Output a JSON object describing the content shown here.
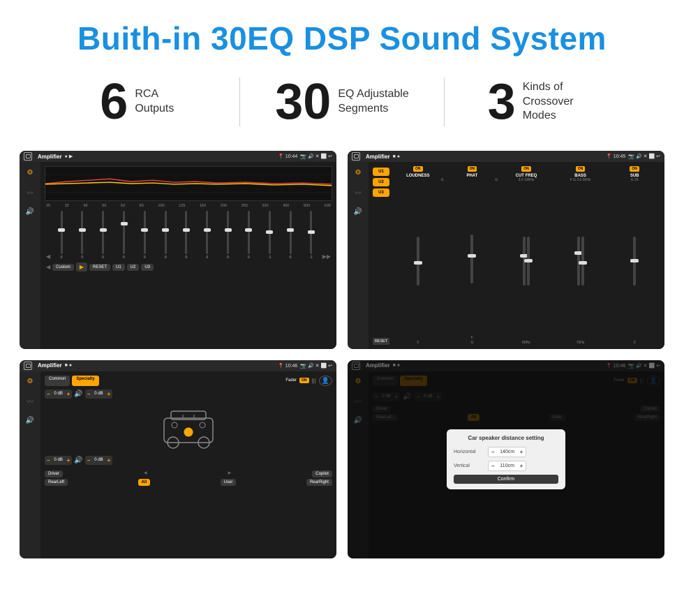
{
  "header": {
    "title": "Buith-in 30EQ DSP Sound System"
  },
  "stats": [
    {
      "number": "6",
      "label": "RCA\nOutputs"
    },
    {
      "number": "30",
      "label": "EQ Adjustable\nSegments"
    },
    {
      "number": "3",
      "label": "Kinds of\nCrossover Modes"
    }
  ],
  "screens": [
    {
      "id": "eq-screen",
      "statusBar": {
        "appName": "Amplifier",
        "time": "10:44"
      },
      "type": "equalizer"
    },
    {
      "id": "amp-screen",
      "statusBar": {
        "appName": "Amplifier",
        "time": "10:45"
      },
      "type": "amplifier"
    },
    {
      "id": "crossover-screen",
      "statusBar": {
        "appName": "Amplifier",
        "time": "10:46"
      },
      "type": "crossover"
    },
    {
      "id": "distance-screen",
      "statusBar": {
        "appName": "Amplifier",
        "time": "10:46"
      },
      "type": "distance",
      "dialog": {
        "title": "Car speaker distance setting",
        "horizontal": "140cm",
        "vertical": "110cm",
        "confirmLabel": "Confirm"
      }
    }
  ],
  "eqScreen": {
    "frequencies": [
      "25",
      "32",
      "40",
      "50",
      "63",
      "80",
      "100",
      "125",
      "160",
      "200",
      "250",
      "320",
      "400",
      "500",
      "630"
    ],
    "values": [
      "0",
      "0",
      "0",
      "5",
      "0",
      "0",
      "0",
      "0",
      "0",
      "0",
      "-1",
      "0",
      "-1"
    ],
    "presetLabel": "Custom",
    "buttons": [
      "RESET",
      "U1",
      "U2",
      "U3"
    ]
  },
  "ampScreen": {
    "presets": [
      "U1",
      "U2",
      "U3"
    ],
    "channels": [
      {
        "name": "LOUDNESS",
        "on": true
      },
      {
        "name": "PHAT",
        "on": true
      },
      {
        "name": "CUT FREQ",
        "on": true
      },
      {
        "name": "BASS",
        "on": true
      },
      {
        "name": "SUB",
        "on": true
      }
    ],
    "resetLabel": "RESET"
  },
  "crossoverScreen": {
    "tabs": [
      "Common",
      "Specialty"
    ],
    "activeTab": "Specialty",
    "faderLabel": "Fader",
    "onLabel": "ON",
    "controls": [
      {
        "label": "",
        "value": "0 dB"
      },
      {
        "label": "",
        "value": "0 dB"
      },
      {
        "label": "",
        "value": "0 dB"
      },
      {
        "label": "",
        "value": "0 dB"
      }
    ],
    "bottomLabels": [
      "Driver",
      "Copilot",
      "RearLeft",
      "All",
      "User",
      "RearRight"
    ]
  },
  "distanceScreen": {
    "tabs": [
      "Common",
      "Specialty"
    ],
    "dialog": {
      "title": "Car speaker distance setting",
      "horizontalLabel": "Horizontal",
      "horizontalValue": "140cm",
      "verticalLabel": "Vertical",
      "verticalValue": "110cm",
      "confirmLabel": "Confirm"
    }
  }
}
